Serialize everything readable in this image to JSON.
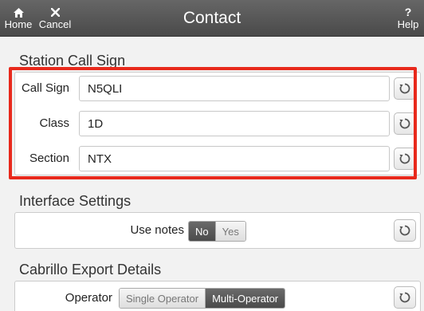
{
  "topbar": {
    "home_label": "Home",
    "cancel_label": "Cancel",
    "title": "Contact",
    "help_label": "Help",
    "help_icon_text": "?"
  },
  "station": {
    "header": "Station Call Sign",
    "fields": [
      {
        "label": "Call Sign",
        "value": "N5QLI"
      },
      {
        "label": "Class",
        "value": "1D"
      },
      {
        "label": "Section",
        "value": "NTX"
      }
    ]
  },
  "interface": {
    "header": "Interface Settings",
    "use_notes_label": "Use notes",
    "options": [
      "No",
      "Yes"
    ],
    "selected": "No"
  },
  "cabrillo": {
    "header": "Cabrillo Export Details",
    "operator_label": "Operator",
    "options": [
      "Single Operator",
      "Multi-Operator"
    ],
    "selected": "Multi-Operator"
  },
  "colors": {
    "highlight": "#e8291c",
    "toolbar": "#555555"
  }
}
